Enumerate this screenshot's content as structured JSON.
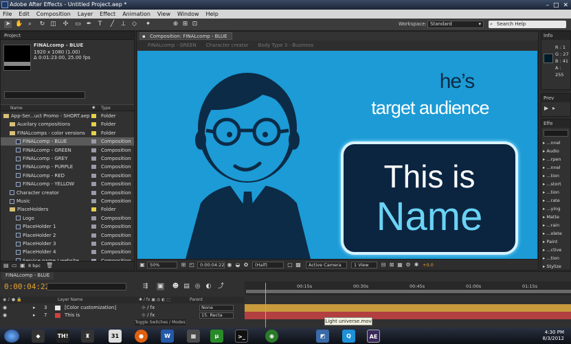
{
  "window": {
    "title": "Adobe After Effects - Untitled Project.aep *"
  },
  "menu": [
    "File",
    "Edit",
    "Composition",
    "Layer",
    "Effect",
    "Animation",
    "View",
    "Window",
    "Help"
  ],
  "toolbar": {
    "workspace_label": "Workspace:",
    "workspace_value": "Standard",
    "search_help": "Search Help"
  },
  "project": {
    "tab": "Project",
    "comp_name": "FINALcomp - BLUE",
    "comp_size": "1920 x 1080 (1.00)",
    "comp_duration": "Δ 0:01:23:00, 25.00 fps",
    "columns": {
      "name": "Name",
      "type": "Type"
    },
    "items": [
      {
        "name": "App-Ser...uct Promo - SHORT.aep",
        "type": "Folder",
        "indent": 0,
        "kind": "folder",
        "color": "#e6d04a"
      },
      {
        "name": "Auxilary compositions",
        "type": "Folder",
        "indent": 1,
        "kind": "folder",
        "color": "#e6d04a"
      },
      {
        "name": "FINALcomps - color versions",
        "type": "Folder",
        "indent": 1,
        "kind": "folder",
        "color": "#e6d04a"
      },
      {
        "name": "FINALcomp - BLUE",
        "type": "Composition",
        "indent": 2,
        "kind": "comp",
        "color": "#9a9aa8",
        "selected": true
      },
      {
        "name": "FINALcomp - GREEN",
        "type": "Composition",
        "indent": 2,
        "kind": "comp",
        "color": "#9a9aa8"
      },
      {
        "name": "FINALcomp - GREY",
        "type": "Composition",
        "indent": 2,
        "kind": "comp",
        "color": "#9a9aa8"
      },
      {
        "name": "FINALcomp - PURPLE",
        "type": "Composition",
        "indent": 2,
        "kind": "comp",
        "color": "#9a9aa8"
      },
      {
        "name": "FINALcomp - RED",
        "type": "Composition",
        "indent": 2,
        "kind": "comp",
        "color": "#9a9aa8"
      },
      {
        "name": "FINALcomp - YELLOW",
        "type": "Composition",
        "indent": 2,
        "kind": "comp",
        "color": "#9a9aa8"
      },
      {
        "name": "Character creator",
        "type": "Composition",
        "indent": 1,
        "kind": "comp",
        "color": "#9a9aa8"
      },
      {
        "name": "Music",
        "type": "Composition",
        "indent": 1,
        "kind": "comp",
        "color": "#9a9aa8"
      },
      {
        "name": "PlaceHolders",
        "type": "Folder",
        "indent": 1,
        "kind": "folder",
        "color": "#e6d04a"
      },
      {
        "name": "Logo",
        "type": "Composition",
        "indent": 2,
        "kind": "comp",
        "color": "#9a9aa8"
      },
      {
        "name": "PlaceHolder 1",
        "type": "Composition",
        "indent": 2,
        "kind": "comp",
        "color": "#9a9aa8"
      },
      {
        "name": "PlaceHolder 2",
        "type": "Composition",
        "indent": 2,
        "kind": "comp",
        "color": "#9a9aa8"
      },
      {
        "name": "PlaceHolder 3",
        "type": "Composition",
        "indent": 2,
        "kind": "comp",
        "color": "#9a9aa8"
      },
      {
        "name": "PlaceHolder 4",
        "type": "Composition",
        "indent": 2,
        "kind": "comp",
        "color": "#9a9aa8"
      },
      {
        "name": "Service name / website",
        "type": "Composition",
        "indent": 2,
        "kind": "comp",
        "color": "#9a9aa8"
      }
    ],
    "bpc": "8 bpc"
  },
  "composition": {
    "tab": "Composition: FINALcomp - BLUE",
    "breadcrumbs": [
      "FINALcomp - GREEN",
      "Character creator",
      "Body Type 3 - Business"
    ],
    "viewer": {
      "line1": "he’s",
      "line2": "target audience",
      "box_line1": "This is",
      "box_line2": "Name",
      "bg_color": "#1c9bd6"
    },
    "controls": {
      "zoom": "50%",
      "timecode": "0:00:04:22",
      "resolution": "(Half)",
      "camera": "Active Camera",
      "views": "1 View",
      "exposure": "+0.0"
    }
  },
  "info": {
    "tab": "Info",
    "r": "R : 1",
    "g": "G : 27",
    "b": "B : 41",
    "a": "A : 255"
  },
  "preview": {
    "tab": "Prev"
  },
  "effects": {
    "tab": "Effe",
    "items": [
      "...nnel",
      "Audio",
      "...rpen",
      "...nnel",
      "...tion",
      "...stort",
      "...tion",
      "...rate",
      "...ying",
      "Matte",
      "...rain",
      "...olete",
      "Paint",
      "...ctive",
      "...tion",
      "Stylize"
    ]
  },
  "timeline": {
    "tab": "FINALcomp - BLUE",
    "timecode": "0:00:04:22",
    "col_layer_name": "Layer Name",
    "col_parent": "Parent",
    "ruler": [
      "00:15s",
      "00:30s",
      "00:45s",
      "01:00s",
      "01:15s"
    ],
    "layers": [
      {
        "num": "3",
        "name": "[Color customization]",
        "parent": "None",
        "color": "#e8e8e8"
      },
      {
        "num": "7",
        "name": "This is",
        "parent": "15. Recta",
        "color": "#d04040"
      }
    ],
    "footer": "Toggle Switches / Modes",
    "tooltip": "Light universe.mov"
  },
  "taskbar": {
    "time": "4:30 PM",
    "date": "8/3/2012",
    "apps": [
      "TH!",
      "31",
      "W",
      "AE"
    ]
  }
}
